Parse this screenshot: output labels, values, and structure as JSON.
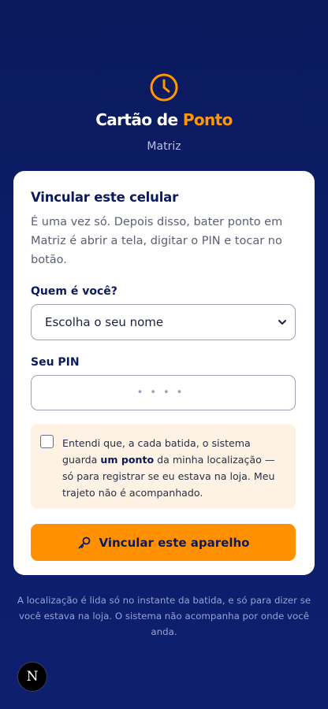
{
  "header": {
    "brand_main": "Cartão de",
    "brand_accent": "Ponto",
    "subtitle": "Matriz",
    "icon": "clock-icon"
  },
  "card": {
    "title": "Vincular este celular",
    "description": "É uma vez só. Depois disso, bater ponto em Matriz é abrir a tela, digitar o PIN e tocar no botão.",
    "who_label": "Quem é você?",
    "name_select": {
      "value": "Escolha o seu nome",
      "icon": "chevron-down-icon"
    },
    "pin_label": "Seu PIN",
    "pin_placeholder": "••••",
    "consent": {
      "checked": false,
      "text_before": "Entendi que, a cada batida, o sistema guarda ",
      "text_bold": "um ponto",
      "text_after": " da minha localização — só para registrar se eu estava na loja. Meu trajeto não é acompanhado."
    },
    "cta_label": "Vincular este aparelho",
    "cta_icon": "key-icon"
  },
  "footer": {
    "text": "A localização é lida só no instante da batida, e só para dizer se você estava na loja. O sistema não acompanha por onde você anda."
  },
  "avatar": {
    "letter": "N"
  },
  "colors": {
    "background": "#0c1d6a",
    "accent": "#ff9100",
    "navy": "#0b1a5c",
    "consent_bg": "#fdf2e3"
  }
}
